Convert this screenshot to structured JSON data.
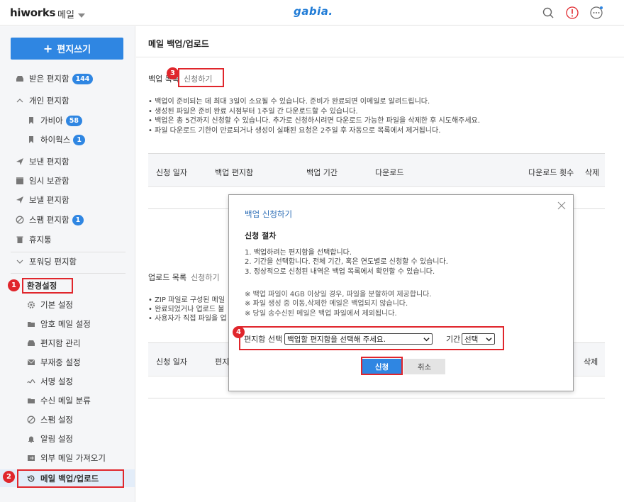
{
  "header": {
    "logo": "hiworks",
    "app_switch": "메일",
    "brand": "gabia."
  },
  "sidebar": {
    "compose": "편지쓰기",
    "inbox": {
      "label": "받은 편지함",
      "count": "144"
    },
    "personal": {
      "label": "개인 편지함"
    },
    "gabia": {
      "label": "가비아",
      "count": "58"
    },
    "hiworks": {
      "label": "하이웍스",
      "count": "1"
    },
    "sent": {
      "label": "보낸 편지함"
    },
    "drafts": {
      "label": "임시 보관함"
    },
    "scheduled": {
      "label": "보낼 편지함"
    },
    "spam": {
      "label": "스팸 편지함",
      "count": "1"
    },
    "trash": {
      "label": "휴지통"
    },
    "forwarding": {
      "label": "포워딩 편지함"
    },
    "settings": {
      "label": "환경설정",
      "items": [
        "기본 설정",
        "암호 메일 설정",
        "편지함 관리",
        "부재중 설정",
        "서명 설정",
        "수신 메일 분류",
        "스팸 설정",
        "알림 설정",
        "외부 메일 가져오기",
        "메일 백업/업로드"
      ]
    }
  },
  "main": {
    "title": "메일 백업/업로드",
    "backup": {
      "label": "백업 목록",
      "apply": "신청하기",
      "notes": [
        "• 백업이 준비되는 데 최대 3일이 소요될 수 있습니다. 준비가 완료되면 이메일로 알려드립니다.",
        "• 생성된 파일은 준비 완료 시점부터 1주일 간 다운로드할 수 있습니다.",
        "• 백업은 총 5건까지 신청할 수 있습니다. 추가로 신청하시려면 다운로드 가능한 파일을 삭제한 후 시도해주세요.",
        "• 파일 다운로드 기한이 만료되거나 생성이 실패된 요청은 2주일 후 자동으로 목록에서 제거됩니다."
      ],
      "columns": [
        "신청 일자",
        "백업 편지함",
        "백업 기간",
        "다운로드",
        "다운로드 횟수",
        "삭제"
      ]
    },
    "upload": {
      "label": "업로드 목록",
      "apply": "신청하기",
      "notes": [
        "• ZIP 파일로 구성된 메일",
        "• 완료되었거나 업로드 불",
        "• 사용자가 직접 파일을 업"
      ],
      "columns": [
        "신청 일자",
        "편지",
        "삭제"
      ]
    }
  },
  "modal": {
    "title": "백업 신청하기",
    "procedure_title": "신청 절차",
    "steps": [
      "1. 백업하려는 편지함을 선택합니다.",
      "2. 기간을 선택합니다. 전체 기간, 혹은 연도별로 신청할 수 있습니다.",
      "3. 정상적으로 신청된 내역은 백업 목록에서 확인할 수 있습니다."
    ],
    "warnings": [
      "※ 백업 파일이 4GB 이상일 경우, 파일을 분할하여 제공합니다.",
      "※ 파일 생성 중 이동,삭제한 메일은 백업되지 않습니다.",
      "※ 당일 송수신된 메일은 백업 파일에서 제외됩니다."
    ],
    "mailbox_label": "편지함 선택",
    "mailbox_value": "백업할 편지함을 선택해 주세요.",
    "period_label": "기간",
    "period_value": "선택",
    "submit": "신청",
    "cancel": "취소"
  },
  "markers": [
    "1",
    "2",
    "3",
    "4"
  ],
  "colors": {
    "accent": "#2f86e2",
    "annotation": "#e0262c"
  }
}
